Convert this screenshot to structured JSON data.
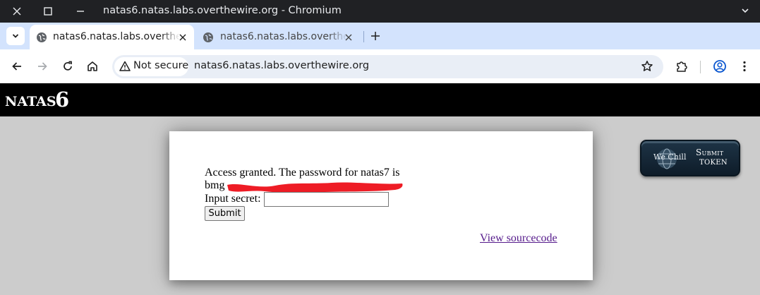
{
  "window": {
    "title": "natas6.natas.labs.overthewire.org - Chromium"
  },
  "tabs": [
    {
      "label": "natas6.natas.labs.overthewire.org",
      "active": true
    },
    {
      "label": "natas6.natas.labs.overthewire.org",
      "active": false
    }
  ],
  "toolbar": {
    "security_label": "Not secure",
    "url": "natas6.natas.labs.overthewire.org"
  },
  "page": {
    "header": {
      "name": "NATAS",
      "number": "6"
    },
    "message_line1": "Access granted. The password for natas7 is",
    "password_prefix": "bmg",
    "input_label": "Input secret:",
    "input_value": "",
    "submit_label": "Submit",
    "view_source_label": "View sourcecode",
    "token_button": {
      "logo_text": "We Chill",
      "line1": "Submit",
      "line2": "TOKEN"
    }
  },
  "colors": {
    "title_bar": "#202124",
    "tab_strip": "#d3e3fd",
    "header_bg": "#000000",
    "page_bg": "#cccccc",
    "link_visited": "#551a8b",
    "redaction": "#ee1c25"
  }
}
